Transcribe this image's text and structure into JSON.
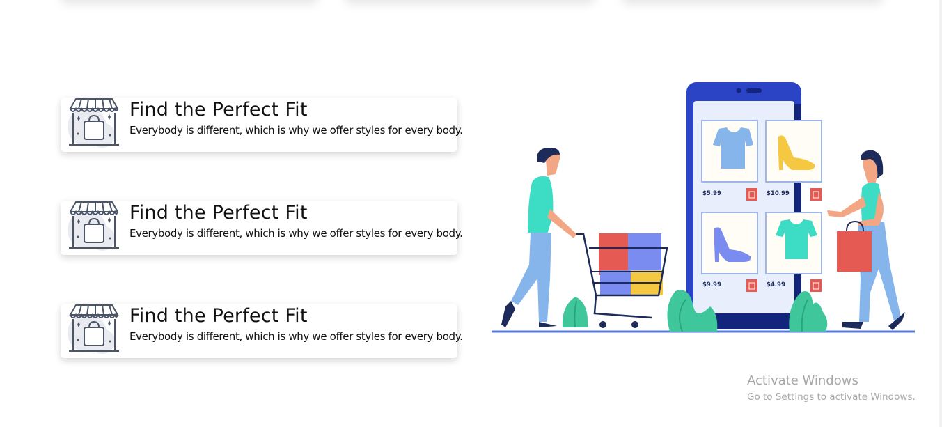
{
  "features": [
    {
      "title": "Find the Perfect Fit",
      "description": "Everybody is different, which is why we offer styles for every body."
    },
    {
      "title": "Find the Perfect Fit",
      "description": "Everybody is different, which is why we offer styles for every body."
    },
    {
      "title": "Find the Perfect Fit",
      "description": "Everybody is different, which is why we offer styles for every body."
    }
  ],
  "illustration": {
    "products": [
      {
        "name": "t-shirt",
        "price": "$5.99",
        "color": "#85b5ea"
      },
      {
        "name": "heel",
        "price": "$10.99",
        "color": "#f5c842"
      },
      {
        "name": "heel",
        "price": "$9.99",
        "color": "#7b8cf0"
      },
      {
        "name": "t-shirt",
        "price": "$4.99",
        "color": "#3ddcc4"
      }
    ]
  },
  "watermark": {
    "line1": "Activate Windows",
    "line2": "Go to Settings to activate Windows."
  },
  "colors": {
    "accent": "#2b44c6",
    "phone_dark": "#13247c",
    "cart_bag_red": "#e55a52"
  }
}
